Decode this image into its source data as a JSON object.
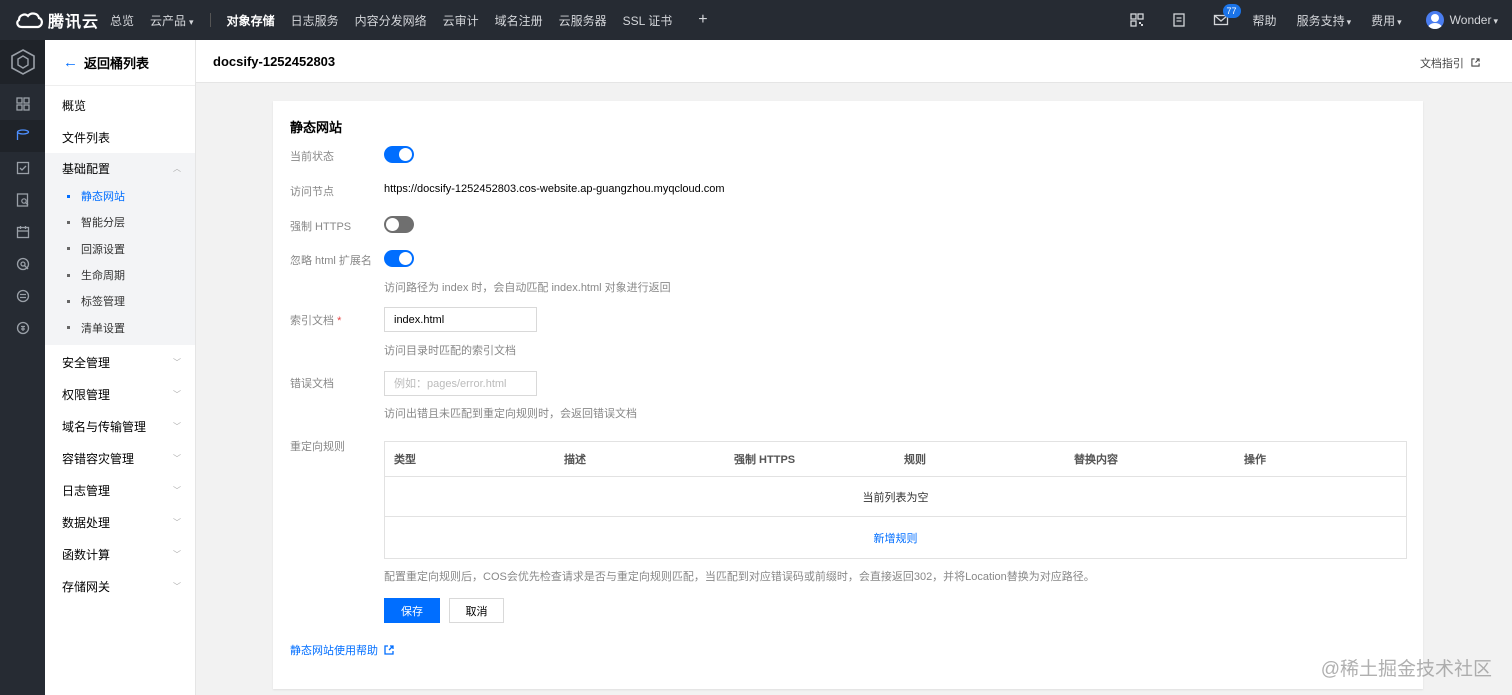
{
  "topbar": {
    "logo_text": "腾讯云",
    "nav": [
      {
        "label": "总览",
        "caret": false,
        "bold": false
      },
      {
        "label": "云产品",
        "caret": true,
        "bold": false
      }
    ],
    "nav_pinned": [
      "对象存储",
      "日志服务",
      "内容分发网络",
      "云审计",
      "域名注册",
      "云服务器",
      "SSL 证书"
    ],
    "plus": "+",
    "mail_badge": "77",
    "links": {
      "help": "帮助",
      "support": "服务支持",
      "billing": "费用",
      "user": "Wonder"
    },
    "icons": [
      "qrcode-icon",
      "document-icon",
      "mail-icon"
    ]
  },
  "rail": {
    "icons": [
      "cube-logo-icon",
      "dashboard-icon",
      "storage-icon",
      "checklist-icon",
      "file-search-icon",
      "calendar-icon",
      "radar-icon",
      "list-circle-icon",
      "coin-icon"
    ],
    "active_index": 2
  },
  "sidebar": {
    "back_label": "返回桶列表",
    "items_top": [
      "概览",
      "文件列表"
    ],
    "group_label": "基础配置",
    "sub_items": [
      "静态网站",
      "智能分层",
      "回源设置",
      "生命周期",
      "标签管理",
      "清单设置"
    ],
    "sub_active_index": 0,
    "items_bottom": [
      "安全管理",
      "权限管理",
      "域名与传输管理",
      "容错容灾管理",
      "日志管理",
      "数据处理",
      "函数计算",
      "存储网关"
    ]
  },
  "header": {
    "bucket_name": "docsify-1252452803",
    "doc_link": "文档指引"
  },
  "form": {
    "title": "静态网站",
    "status_label": "当前状态",
    "status_on": true,
    "endpoint_label": "访问节点",
    "endpoint_value": "https://docsify-1252452803.cos-website.ap-guangzhou.myqcloud.com",
    "https_label": "强制 HTTPS",
    "https_on": false,
    "ignore_ext_label": "忽略 html 扩展名",
    "ignore_ext_on": true,
    "ignore_ext_hint": "访问路径为 index 时，会自动匹配 index.html 对象进行返回",
    "index_label": "索引文档",
    "index_required_mark": "*",
    "index_value": "index.html",
    "index_hint": "访问目录时匹配的索引文档",
    "error_label": "错误文档",
    "error_placeholder": "例如：pages/error.html",
    "error_hint": "访问出错且未匹配到重定向规则时，会返回错误文档",
    "redirect_label": "重定向规则",
    "table_headers": [
      "类型",
      "描述",
      "强制 HTTPS",
      "规则",
      "替换内容",
      "操作"
    ],
    "table_empty": "当前列表为空",
    "add_rule": "新增规则",
    "redirect_hint": "配置重定向规则后，COS会优先检查请求是否与重定向规则匹配，当匹配到对应错误码或前缀时，会直接返回302，并将Location替换为对应路径。",
    "save": "保存",
    "cancel": "取消",
    "help_link": "静态网站使用帮助"
  },
  "watermark": "@稀土掘金技术社区"
}
